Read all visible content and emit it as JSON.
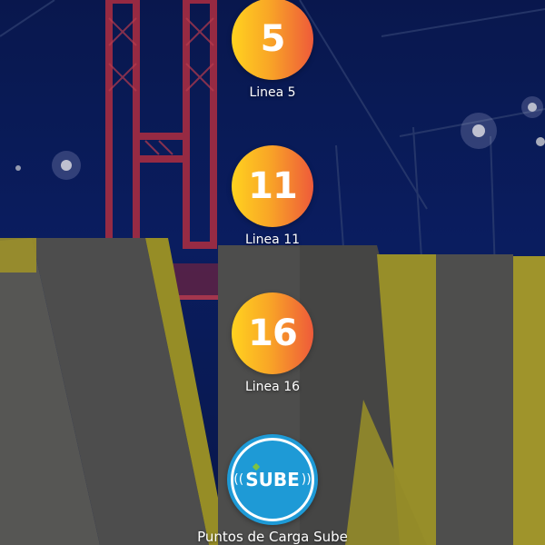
{
  "lines": [
    {
      "number": "5",
      "label": "Linea 5"
    },
    {
      "number": "11",
      "label": "Linea 11"
    },
    {
      "number": "16",
      "label": "Linea 16"
    }
  ],
  "sube": {
    "logo_text": "SUBE",
    "label": "Puntos de Carga Sube"
  },
  "colors": {
    "badge_gradient_start": "#ffd21f",
    "badge_gradient_end": "#ee5a3a",
    "sube_blue": "#1e9ad6",
    "background": "#0b1d5a"
  }
}
